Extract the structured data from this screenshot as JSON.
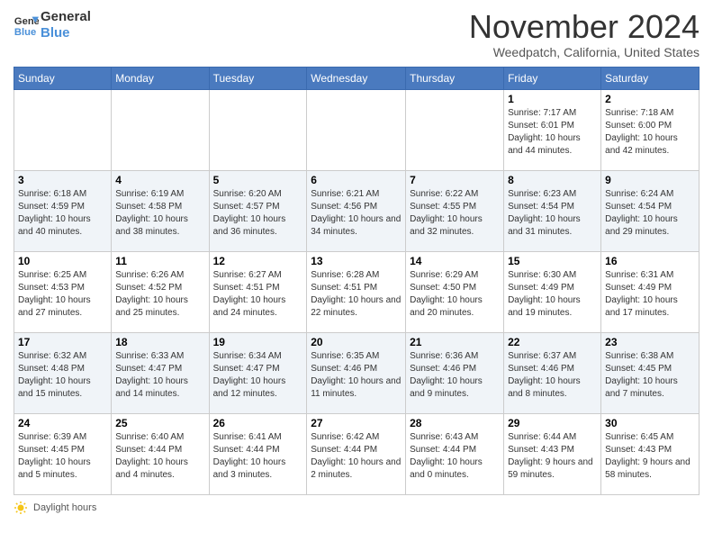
{
  "header": {
    "logo_line1": "General",
    "logo_line2": "Blue",
    "title": "November 2024",
    "subtitle": "Weedpatch, California, United States"
  },
  "days_of_week": [
    "Sunday",
    "Monday",
    "Tuesday",
    "Wednesday",
    "Thursday",
    "Friday",
    "Saturday"
  ],
  "weeks": [
    [
      {
        "day": "",
        "info": ""
      },
      {
        "day": "",
        "info": ""
      },
      {
        "day": "",
        "info": ""
      },
      {
        "day": "",
        "info": ""
      },
      {
        "day": "",
        "info": ""
      },
      {
        "day": "1",
        "info": "Sunrise: 7:17 AM\nSunset: 6:01 PM\nDaylight: 10 hours and 44 minutes."
      },
      {
        "day": "2",
        "info": "Sunrise: 7:18 AM\nSunset: 6:00 PM\nDaylight: 10 hours and 42 minutes."
      }
    ],
    [
      {
        "day": "3",
        "info": "Sunrise: 6:18 AM\nSunset: 4:59 PM\nDaylight: 10 hours and 40 minutes."
      },
      {
        "day": "4",
        "info": "Sunrise: 6:19 AM\nSunset: 4:58 PM\nDaylight: 10 hours and 38 minutes."
      },
      {
        "day": "5",
        "info": "Sunrise: 6:20 AM\nSunset: 4:57 PM\nDaylight: 10 hours and 36 minutes."
      },
      {
        "day": "6",
        "info": "Sunrise: 6:21 AM\nSunset: 4:56 PM\nDaylight: 10 hours and 34 minutes."
      },
      {
        "day": "7",
        "info": "Sunrise: 6:22 AM\nSunset: 4:55 PM\nDaylight: 10 hours and 32 minutes."
      },
      {
        "day": "8",
        "info": "Sunrise: 6:23 AM\nSunset: 4:54 PM\nDaylight: 10 hours and 31 minutes."
      },
      {
        "day": "9",
        "info": "Sunrise: 6:24 AM\nSunset: 4:54 PM\nDaylight: 10 hours and 29 minutes."
      }
    ],
    [
      {
        "day": "10",
        "info": "Sunrise: 6:25 AM\nSunset: 4:53 PM\nDaylight: 10 hours and 27 minutes."
      },
      {
        "day": "11",
        "info": "Sunrise: 6:26 AM\nSunset: 4:52 PM\nDaylight: 10 hours and 25 minutes."
      },
      {
        "day": "12",
        "info": "Sunrise: 6:27 AM\nSunset: 4:51 PM\nDaylight: 10 hours and 24 minutes."
      },
      {
        "day": "13",
        "info": "Sunrise: 6:28 AM\nSunset: 4:51 PM\nDaylight: 10 hours and 22 minutes."
      },
      {
        "day": "14",
        "info": "Sunrise: 6:29 AM\nSunset: 4:50 PM\nDaylight: 10 hours and 20 minutes."
      },
      {
        "day": "15",
        "info": "Sunrise: 6:30 AM\nSunset: 4:49 PM\nDaylight: 10 hours and 19 minutes."
      },
      {
        "day": "16",
        "info": "Sunrise: 6:31 AM\nSunset: 4:49 PM\nDaylight: 10 hours and 17 minutes."
      }
    ],
    [
      {
        "day": "17",
        "info": "Sunrise: 6:32 AM\nSunset: 4:48 PM\nDaylight: 10 hours and 15 minutes."
      },
      {
        "day": "18",
        "info": "Sunrise: 6:33 AM\nSunset: 4:47 PM\nDaylight: 10 hours and 14 minutes."
      },
      {
        "day": "19",
        "info": "Sunrise: 6:34 AM\nSunset: 4:47 PM\nDaylight: 10 hours and 12 minutes."
      },
      {
        "day": "20",
        "info": "Sunrise: 6:35 AM\nSunset: 4:46 PM\nDaylight: 10 hours and 11 minutes."
      },
      {
        "day": "21",
        "info": "Sunrise: 6:36 AM\nSunset: 4:46 PM\nDaylight: 10 hours and 9 minutes."
      },
      {
        "day": "22",
        "info": "Sunrise: 6:37 AM\nSunset: 4:46 PM\nDaylight: 10 hours and 8 minutes."
      },
      {
        "day": "23",
        "info": "Sunrise: 6:38 AM\nSunset: 4:45 PM\nDaylight: 10 hours and 7 minutes."
      }
    ],
    [
      {
        "day": "24",
        "info": "Sunrise: 6:39 AM\nSunset: 4:45 PM\nDaylight: 10 hours and 5 minutes."
      },
      {
        "day": "25",
        "info": "Sunrise: 6:40 AM\nSunset: 4:44 PM\nDaylight: 10 hours and 4 minutes."
      },
      {
        "day": "26",
        "info": "Sunrise: 6:41 AM\nSunset: 4:44 PM\nDaylight: 10 hours and 3 minutes."
      },
      {
        "day": "27",
        "info": "Sunrise: 6:42 AM\nSunset: 4:44 PM\nDaylight: 10 hours and 2 minutes."
      },
      {
        "day": "28",
        "info": "Sunrise: 6:43 AM\nSunset: 4:44 PM\nDaylight: 10 hours and 0 minutes."
      },
      {
        "day": "29",
        "info": "Sunrise: 6:44 AM\nSunset: 4:43 PM\nDaylight: 9 hours and 59 minutes."
      },
      {
        "day": "30",
        "info": "Sunrise: 6:45 AM\nSunset: 4:43 PM\nDaylight: 9 hours and 58 minutes."
      }
    ]
  ],
  "footer": {
    "note": "Daylight hours"
  }
}
